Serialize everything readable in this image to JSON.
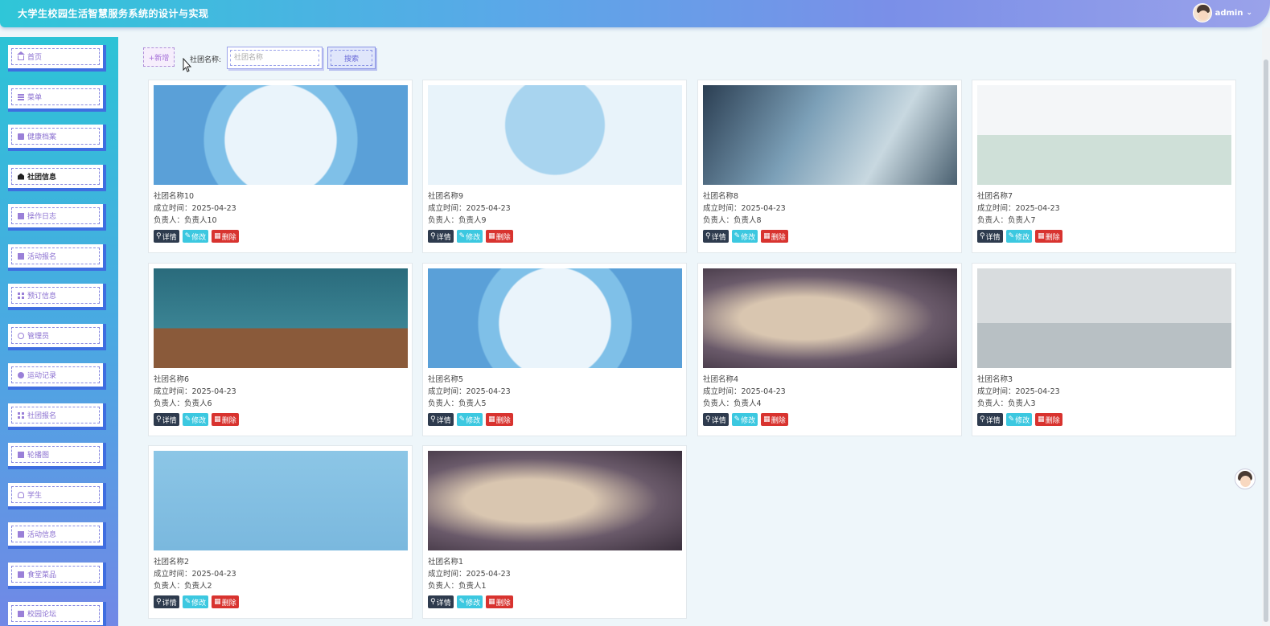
{
  "header": {
    "title": "大学生校园生活智慧服务系统的设计与实现",
    "username": "admin"
  },
  "sidebar": {
    "items": [
      {
        "label": "首页",
        "icon": "home-icon"
      },
      {
        "label": "菜单",
        "icon": "menu-icon"
      },
      {
        "label": "健康档案",
        "icon": "file-icon"
      },
      {
        "label": "社团信息",
        "icon": "bank-icon",
        "active": true
      },
      {
        "label": "操作日志",
        "icon": "log-icon"
      },
      {
        "label": "活动报名",
        "icon": "list-icon"
      },
      {
        "label": "预订信息",
        "icon": "grid-icon"
      },
      {
        "label": "管理员",
        "icon": "admin-icon"
      },
      {
        "label": "运动记录",
        "icon": "record-icon"
      },
      {
        "label": "社团报名",
        "icon": "grid-icon"
      },
      {
        "label": "轮播图",
        "icon": "image-icon"
      },
      {
        "label": "学生",
        "icon": "user-icon"
      },
      {
        "label": "活动信息",
        "icon": "info-icon"
      },
      {
        "label": "食堂菜品",
        "icon": "food-icon"
      },
      {
        "label": "校园论坛",
        "icon": "forum-icon"
      }
    ]
  },
  "toolbar": {
    "add_label": "+新增",
    "search_label": "社团名称:",
    "search_placeholder": "社团名称",
    "search_button": "搜索"
  },
  "actions": {
    "detail": "详情",
    "edit": "修改",
    "delete": "删除"
  },
  "clubs": [
    {
      "name": "社团名称10",
      "date": "成立时间：2025-04-23",
      "owner": "负责人：负责人10",
      "pic": "globe"
    },
    {
      "name": "社团名称9",
      "date": "成立时间：2025-04-23",
      "owner": "负责人：负责人9",
      "pic": "map"
    },
    {
      "name": "社团名称8",
      "date": "成立时间：2025-04-23",
      "owner": "负责人：负责人8",
      "pic": "tech"
    },
    {
      "name": "社团名称7",
      "date": "成立时间：2025-04-23",
      "owner": "负责人：负责人7",
      "pic": "people"
    },
    {
      "name": "社团名称6",
      "date": "成立时间：2025-04-23",
      "owner": "负责人：负责人6",
      "pic": "party"
    },
    {
      "name": "社团名称5",
      "date": "成立时间：2025-04-23",
      "owner": "负责人：负责人5",
      "pic": "globe"
    },
    {
      "name": "社团名称4",
      "date": "成立时间：2025-04-23",
      "owner": "负责人：负责人4",
      "pic": "phone"
    },
    {
      "name": "社团名称3",
      "date": "成立时间：2025-04-23",
      "owner": "负责人：负责人3",
      "pic": "sofa"
    },
    {
      "name": "社团名称2",
      "date": "成立时间：2025-04-23",
      "owner": "负责人：负责人2",
      "pic": "net"
    },
    {
      "name": "社团名称1",
      "date": "成立时间：2025-04-23",
      "owner": "负责人：负责人1",
      "pic": "phone"
    }
  ]
}
